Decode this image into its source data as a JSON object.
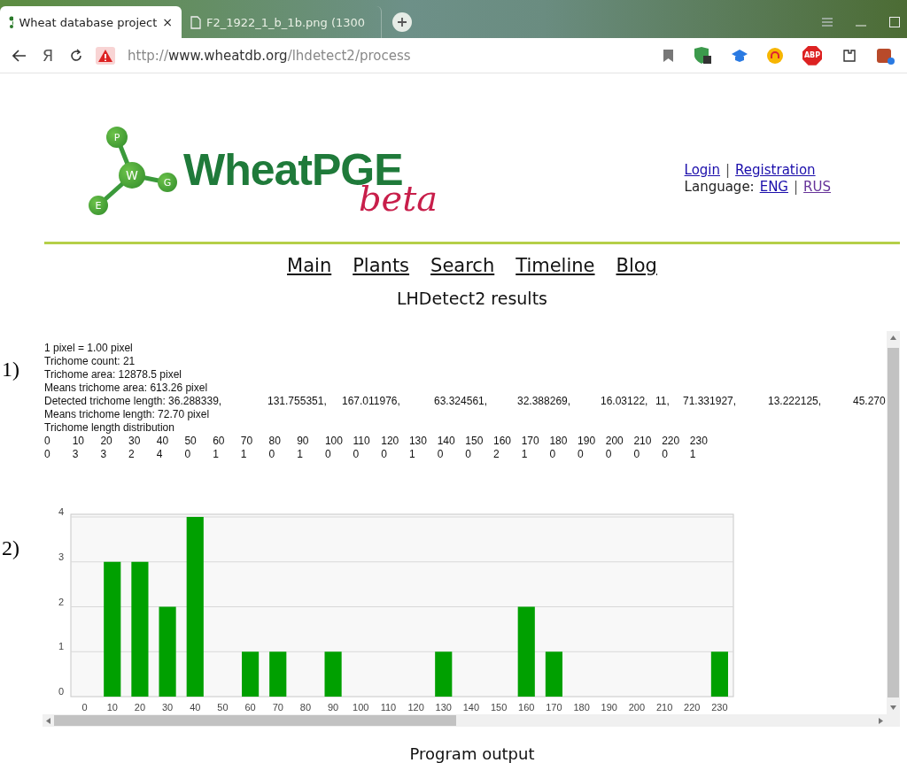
{
  "tabs": [
    {
      "title": "Wheat database project",
      "close": "×",
      "selected": true
    },
    {
      "title": "F2_1922_1_b_1b.png (1300",
      "selected": false
    }
  ],
  "address_bar": {
    "browser_button": "Я",
    "url_prefix": "http://",
    "url_domain": "www.wheatdb.org",
    "url_path": "/lhdetect2/process",
    "adblock": "ABP"
  },
  "figure_labels": [
    "1)",
    "2)"
  ],
  "logo": {
    "nodes": [
      "P",
      "W",
      "G",
      "E"
    ],
    "name": "WheatPGE",
    "tag": "beta"
  },
  "account": {
    "login": "Login",
    "login_separator": "|",
    "registration": "Registration",
    "language_label": "Language:",
    "language_separator": "|",
    "languages": [
      {
        "label": "ENG",
        "visited": false
      },
      {
        "label": "RUS",
        "visited": true
      }
    ]
  },
  "nav": [
    "Main",
    "Plants",
    "Search",
    "Timeline",
    "Blog"
  ],
  "page_title": "LHDetect2 results",
  "output": {
    "lines": [
      "1 pixel = 1.00 pixel",
      "Trichome count: 21",
      "Trichome area: 12878.5 pixel",
      "Means trichome area: 613.26 pixel"
    ],
    "detected_label": "Detected trichome length: 36.288339,",
    "detected_values": [
      "131.755351,",
      "167.011976,",
      "63.324561,",
      "32.388269,",
      "16.03122,",
      "11,",
      "71.331927,",
      "13.222125,",
      "45.270"
    ],
    "lines_after": [
      "Means trichome length: 72.70 pixel",
      "Trichome length distribution"
    ],
    "bins": [
      "0",
      "10",
      "20",
      "30",
      "40",
      "50",
      "60",
      "70",
      "80",
      "90",
      "100",
      "110",
      "120",
      "130",
      "140",
      "150",
      "160",
      "170",
      "180",
      "190",
      "200",
      "210",
      "220",
      "230"
    ],
    "counts": [
      "0",
      "3",
      "3",
      "2",
      "4",
      "0",
      "1",
      "1",
      "0",
      "1",
      "0",
      "0",
      "0",
      "1",
      "0",
      "0",
      "2",
      "1",
      "0",
      "0",
      "0",
      "0",
      "0",
      "1"
    ],
    "chart_data": {
      "type": "bar",
      "categories": [
        "0",
        "10",
        "20",
        "30",
        "40",
        "50",
        "60",
        "70",
        "80",
        "90",
        "100",
        "110",
        "120",
        "130",
        "140",
        "150",
        "160",
        "170",
        "180",
        "190",
        "200",
        "210",
        "220",
        "230"
      ],
      "series": [
        {
          "color": "#00a000",
          "values": [
            0,
            3,
            3,
            2,
            4,
            0,
            1,
            1,
            0,
            1,
            0,
            0,
            0,
            1,
            0,
            0,
            2,
            1,
            0,
            0,
            0,
            0,
            0,
            1
          ]
        }
      ],
      "ylim": [
        0,
        4
      ],
      "yticks": [
        0,
        1,
        2,
        3,
        4
      ],
      "grid": true
    }
  },
  "footer": "Program output"
}
